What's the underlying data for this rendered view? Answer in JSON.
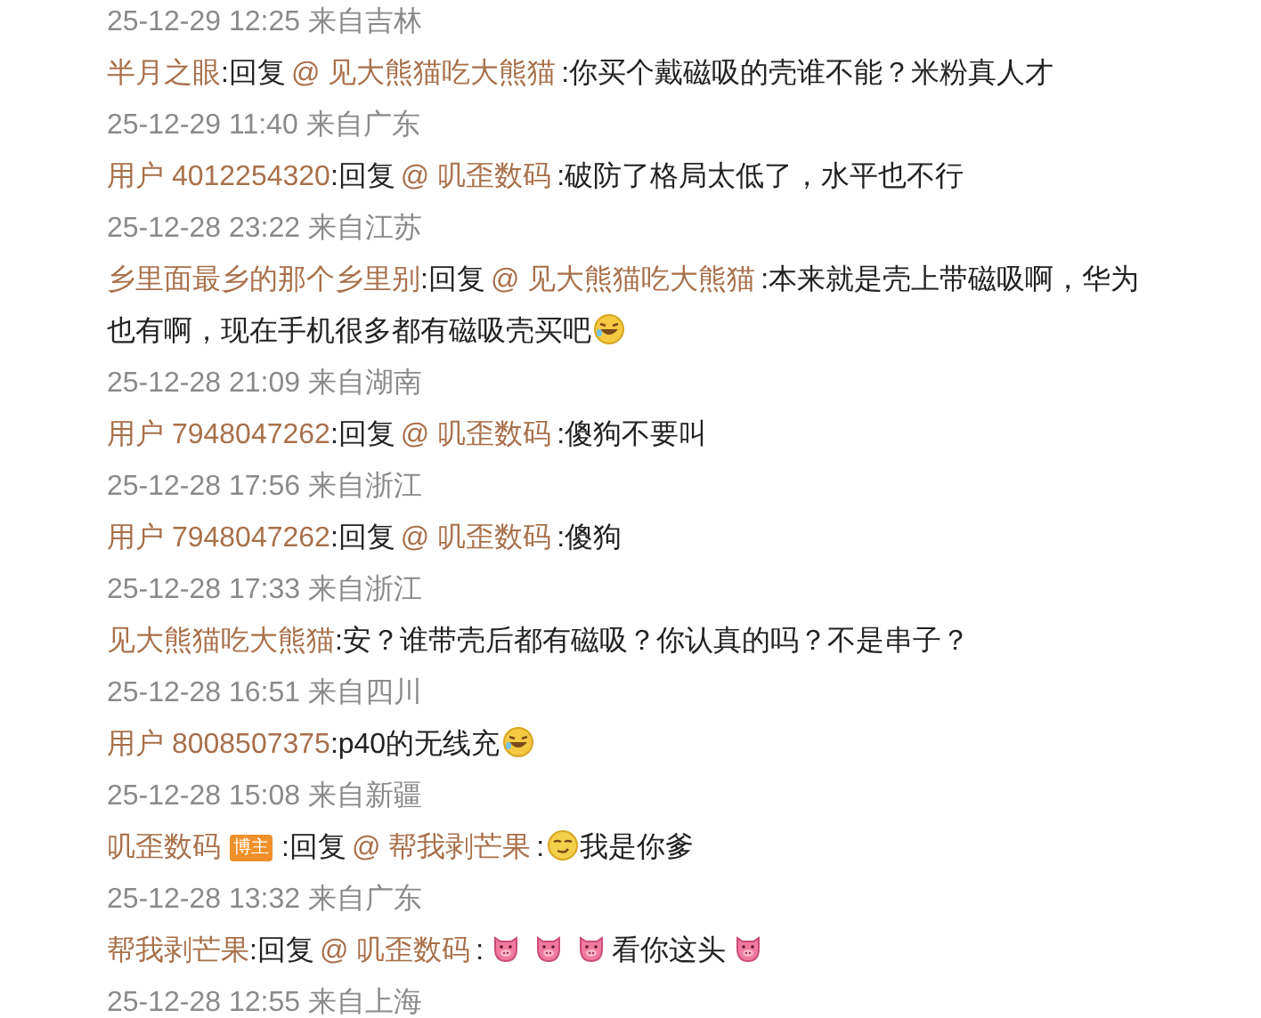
{
  "entries": [
    {
      "kind": "time",
      "text": "25-12-29 12:25 来自吉林"
    },
    {
      "kind": "comment",
      "author": "半月之眼",
      "parts": [
        {
          "kind": "text",
          "text": ":回复"
        },
        {
          "kind": "mention",
          "text": "@ 见大熊猫吃大熊猫"
        },
        {
          "kind": "text",
          "text": ":你买个戴磁吸的壳谁不能？米粉真人才"
        }
      ]
    },
    {
      "kind": "time",
      "text": "25-12-29 11:40 来自广东"
    },
    {
      "kind": "comment",
      "author": "用户 4012254320",
      "parts": [
        {
          "kind": "text",
          "text": ":回复"
        },
        {
          "kind": "mention",
          "text": "@ 叽歪数码"
        },
        {
          "kind": "text",
          "text": ":破防了格局太低了，水平也不行"
        }
      ]
    },
    {
      "kind": "time",
      "text": "25-12-28 23:22 来自江苏"
    },
    {
      "kind": "comment",
      "author": "乡里面最乡的那个乡里别",
      "parts": [
        {
          "kind": "text",
          "text": ":回复"
        },
        {
          "kind": "mention",
          "text": "@ 见大熊猫吃大熊猫"
        },
        {
          "kind": "text",
          "text": ":本来就是壳上带磁吸啊，华为也有啊，现在手机很多都有磁吸壳买吧"
        },
        {
          "kind": "laugh-emoji"
        }
      ]
    },
    {
      "kind": "time",
      "text": "25-12-28 21:09 来自湖南"
    },
    {
      "kind": "comment",
      "author": "用户 7948047262",
      "parts": [
        {
          "kind": "text",
          "text": ":回复"
        },
        {
          "kind": "mention",
          "text": "@ 叽歪数码"
        },
        {
          "kind": "text",
          "text": ":傻狗不要叫"
        }
      ]
    },
    {
      "kind": "time",
      "text": "25-12-28 17:56 来自浙江"
    },
    {
      "kind": "comment",
      "author": "用户 7948047262",
      "parts": [
        {
          "kind": "text",
          "text": ":回复"
        },
        {
          "kind": "mention",
          "text": "@ 叽歪数码"
        },
        {
          "kind": "text",
          "text": ":傻狗"
        }
      ]
    },
    {
      "kind": "time",
      "text": "25-12-28 17:33 来自浙江"
    },
    {
      "kind": "comment",
      "author": "见大熊猫吃大熊猫",
      "parts": [
        {
          "kind": "text",
          "text": ":安？谁带壳后都有磁吸？你认真的吗？不是串子？"
        }
      ]
    },
    {
      "kind": "time",
      "text": "25-12-28 16:51 来自四川"
    },
    {
      "kind": "comment",
      "author": "用户 8008507375",
      "parts": [
        {
          "kind": "text",
          "text": ":p40的无线充"
        },
        {
          "kind": "laugh-emoji"
        }
      ]
    },
    {
      "kind": "time",
      "text": "25-12-28 15:08 来自新疆"
    },
    {
      "kind": "comment",
      "author": "叽歪数码",
      "badge": "博主",
      "parts": [
        {
          "kind": "text",
          "text": ":回复"
        },
        {
          "kind": "mention",
          "text": "@ 帮我剥芒果"
        },
        {
          "kind": "text",
          "text": ":"
        },
        {
          "kind": "smug-emoji"
        },
        {
          "kind": "text",
          "text": "我是你爹"
        }
      ]
    },
    {
      "kind": "time",
      "text": "25-12-28 13:32 来自广东"
    },
    {
      "kind": "comment",
      "author": "帮我剥芒果",
      "parts": [
        {
          "kind": "text",
          "text": ":回复"
        },
        {
          "kind": "mention",
          "text": "@ 叽歪数码"
        },
        {
          "kind": "text",
          "text": ":"
        },
        {
          "kind": "pig-emoji"
        },
        {
          "kind": "pig-emoji"
        },
        {
          "kind": "pig-emoji"
        },
        {
          "kind": "text",
          "text": "看你这头"
        },
        {
          "kind": "pig-emoji"
        }
      ]
    },
    {
      "kind": "time",
      "text": "25-12-28 12:55 来自上海"
    }
  ]
}
